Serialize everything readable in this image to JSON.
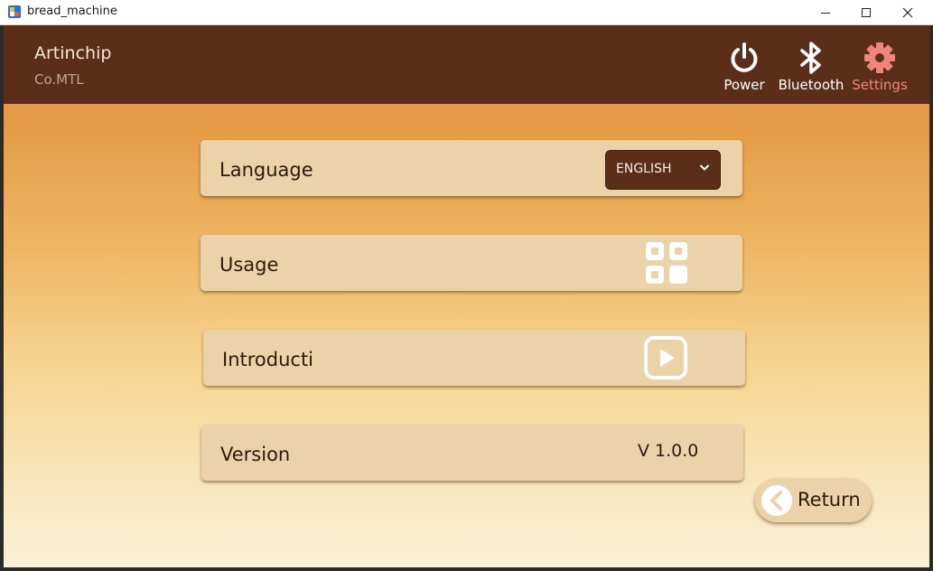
{
  "window": {
    "title": "bread_machine",
    "controls": {
      "minimize": "minimize-icon",
      "maximize": "maximize-icon",
      "close": "close-icon"
    }
  },
  "header": {
    "brand_title": "Artinchip",
    "brand_sub": "Co.MTL",
    "nav": [
      {
        "label": "Power",
        "icon": "power-icon",
        "active": false
      },
      {
        "label": "Bluetooth",
        "icon": "bluetooth-icon",
        "active": false
      },
      {
        "label": "Settings",
        "icon": "settings-gear-icon",
        "active": true
      }
    ]
  },
  "settings": {
    "language": {
      "label": "Language",
      "selected": "ENGLISH"
    },
    "usage": {
      "label": "Usage",
      "icon": "apps-grid-icon"
    },
    "introduction": {
      "label": "Introducti",
      "icon": "play-icon"
    },
    "version": {
      "label": "Version",
      "value": "V 1.0.0"
    }
  },
  "return_button": {
    "label": "Return",
    "icon": "chevron-left-icon"
  },
  "colors": {
    "header_bg": "#5a2e18",
    "card_bg": "#ecd2a9",
    "active_nav": "#f0857c",
    "gradient_top": "#e39c4e",
    "gradient_bottom": "#fbf0d8"
  }
}
